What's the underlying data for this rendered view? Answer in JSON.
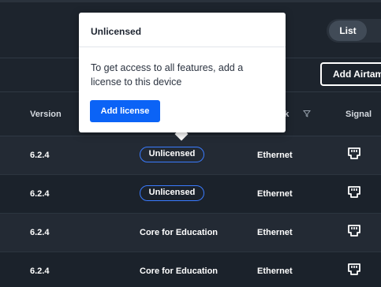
{
  "toolbar": {
    "view_toggle": {
      "list_label": "List"
    },
    "add_button_label": "Add Airtame"
  },
  "table": {
    "headers": {
      "version": "Version",
      "network": "rk",
      "signal": "Signal"
    },
    "rows": [
      {
        "version": "6.2.4",
        "license": "Unlicensed",
        "license_is_badge": true,
        "network": "Ethernet",
        "signal_icon": "ethernet-port-icon"
      },
      {
        "version": "6.2.4",
        "license": "Unlicensed",
        "license_is_badge": true,
        "network": "Ethernet",
        "signal_icon": "ethernet-port-icon"
      },
      {
        "version": "6.2.4",
        "license": "Core for Education",
        "license_is_badge": false,
        "network": "Ethernet",
        "signal_icon": "ethernet-port-icon"
      },
      {
        "version": "6.2.4",
        "license": "Core for Education",
        "license_is_badge": false,
        "network": "Ethernet",
        "signal_icon": "ethernet-port-icon"
      }
    ]
  },
  "popover": {
    "title": "Unlicensed",
    "body": "To get access to all features, add a license to this device",
    "button_label": "Add license"
  },
  "colors": {
    "background": "#1b222b",
    "accent_blue": "#0b63f6",
    "badge_border": "#3a7bff"
  }
}
